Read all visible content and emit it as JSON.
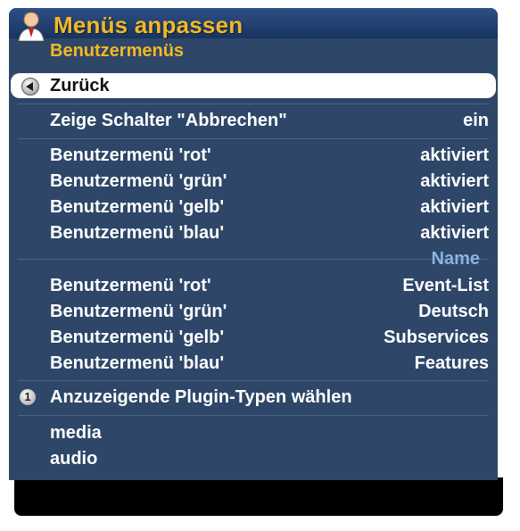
{
  "window": {
    "title": "Menüs anpassen",
    "subtitle": "Benutzermenüs"
  },
  "back_item": {
    "label": "Zurück",
    "icon": "back-arrow-icon"
  },
  "cancel_toggle": {
    "label": "Zeige Schalter \"Abbrechen\"",
    "value": "ein"
  },
  "color_menus": [
    {
      "label": "Benutzermenü 'rot'",
      "value": "aktiviert"
    },
    {
      "label": "Benutzermenü 'grün'",
      "value": "aktiviert"
    },
    {
      "label": "Benutzermenü 'gelb'",
      "value": "aktiviert"
    },
    {
      "label": "Benutzermenü 'blau'",
      "value": "aktiviert"
    }
  ],
  "name_section": {
    "header": "Name",
    "items": [
      {
        "label": "Benutzermenü 'rot'",
        "value": "Event-List"
      },
      {
        "label": "Benutzermenü 'grün'",
        "value": "Deutsch"
      },
      {
        "label": "Benutzermenü 'gelb'",
        "value": "Subservices"
      },
      {
        "label": "Benutzermenü 'blau'",
        "value": "Features"
      }
    ]
  },
  "plugin_types": {
    "label": "Anzuzeigende Plugin-Typen wählen",
    "icon_number": "1",
    "items": [
      "media",
      "audio"
    ]
  },
  "colors": {
    "panel": "#2e4668",
    "accent": "#f2b824",
    "section_header": "#8ab4e0",
    "selected_bg": "#ffffff"
  }
}
